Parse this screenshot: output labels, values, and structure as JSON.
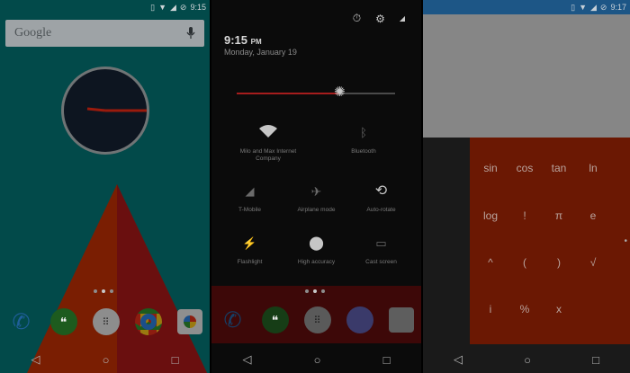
{
  "screens": [
    {
      "status": {
        "vibrate_icon": "vibrate-icon",
        "wifi_icon": "wifi-icon",
        "time": "9:15"
      },
      "search": {
        "brand": "Google",
        "mic_icon": "microphone-icon"
      },
      "dock": [
        "phone-icon",
        "hangouts-icon",
        "app-drawer-icon",
        "chrome-icon",
        "photos-icon"
      ],
      "nav": {
        "back": "◁",
        "home": "○",
        "recents": "□"
      }
    },
    {
      "time_main": "9:15",
      "time_suffix": "PM",
      "date": "Monday, January 19",
      "brightness_percent": 65,
      "tiles": [
        {
          "label": "Milo and Max Internet Company",
          "icon": "wifi-icon"
        },
        {
          "label": "Bluetooth",
          "icon": "bluetooth-icon"
        },
        {
          "label": "T-Mobile",
          "icon": "signal-icon"
        },
        {
          "label": "Airplane mode",
          "icon": "airplane-icon"
        },
        {
          "label": "Auto-rotate",
          "icon": "rotate-icon"
        },
        {
          "label": "Flashlight",
          "icon": "flashlight-icon"
        },
        {
          "label": "High accuracy",
          "icon": "location-icon"
        },
        {
          "label": "Cast screen",
          "icon": "cast-icon"
        }
      ],
      "nav": {
        "back": "◁",
        "home": "○",
        "recents": "□"
      }
    },
    {
      "status": {
        "time": "9:17"
      },
      "functions": [
        "sin",
        "cos",
        "tan",
        "ln",
        "log",
        "!",
        "π",
        "e",
        "^",
        "(",
        ")",
        "√",
        "i",
        "%",
        "x"
      ],
      "nav": {
        "back": "◁",
        "home": "○",
        "recents": "□"
      }
    }
  ]
}
